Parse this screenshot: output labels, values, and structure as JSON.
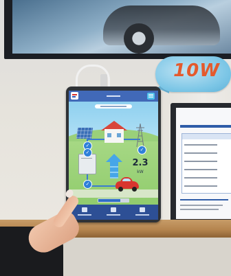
{
  "speech_bubble": {
    "text": "10W"
  },
  "tablet_app": {
    "header": {
      "logo_icon": "app-logo-icon",
      "menu_icon": "menu-icon"
    },
    "energy_flow": {
      "power_value": "2.3",
      "power_unit": "kW",
      "nodes": [
        "solar",
        "battery",
        "house",
        "grid",
        "car"
      ],
      "flow_direction": "battery-to-house"
    },
    "charge_progress": {
      "fraction": 0.72
    },
    "bottom_nav": {
      "items": [
        {
          "icon": "home-icon"
        },
        {
          "icon": "history-icon"
        },
        {
          "icon": "settings-icon"
        }
      ]
    }
  },
  "colors": {
    "app_header": "#4169b8",
    "nav_bar": "#2d4f95",
    "flow_arrow": "#46a6e8",
    "house_roof": "#d8453a",
    "car": "#d8362f",
    "bubble_text": "#e45a2d"
  }
}
